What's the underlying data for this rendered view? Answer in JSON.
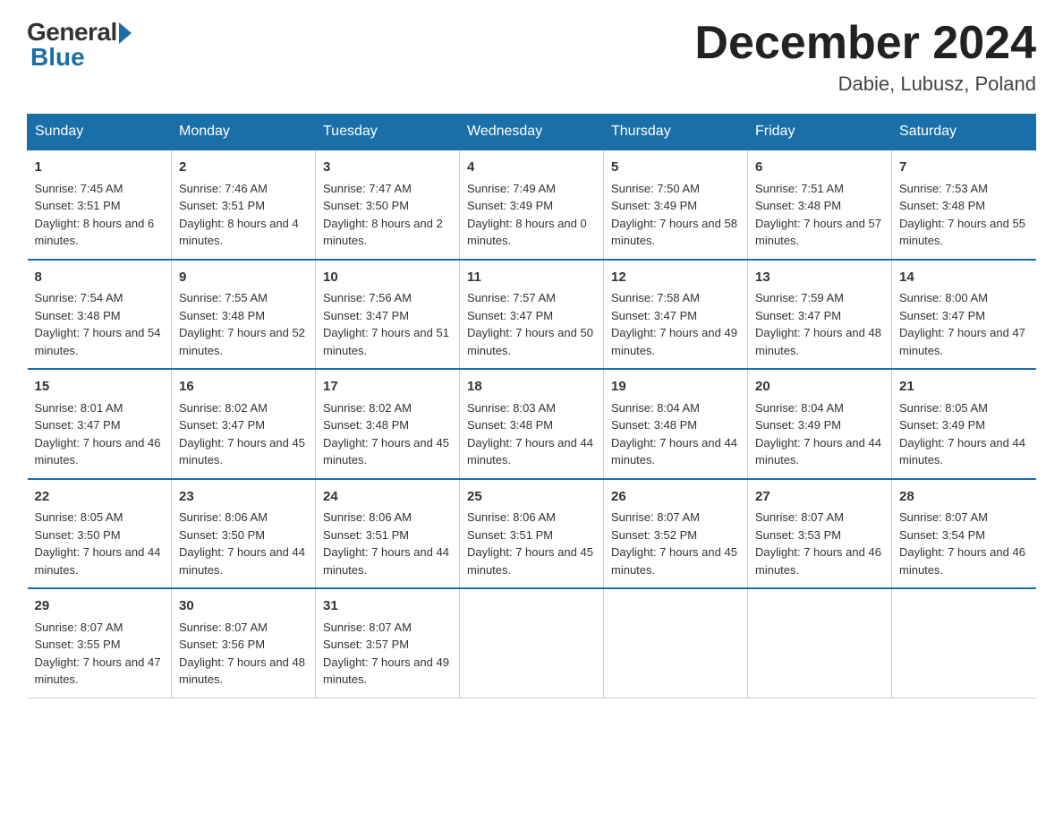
{
  "header": {
    "logo_general": "General",
    "logo_blue": "Blue",
    "title": "December 2024",
    "location": "Dabie, Lubusz, Poland"
  },
  "days_of_week": [
    "Sunday",
    "Monday",
    "Tuesday",
    "Wednesday",
    "Thursday",
    "Friday",
    "Saturday"
  ],
  "weeks": [
    [
      {
        "day": 1,
        "sunrise": "7:45 AM",
        "sunset": "3:51 PM",
        "daylight": "8 hours and 6 minutes."
      },
      {
        "day": 2,
        "sunrise": "7:46 AM",
        "sunset": "3:51 PM",
        "daylight": "8 hours and 4 minutes."
      },
      {
        "day": 3,
        "sunrise": "7:47 AM",
        "sunset": "3:50 PM",
        "daylight": "8 hours and 2 minutes."
      },
      {
        "day": 4,
        "sunrise": "7:49 AM",
        "sunset": "3:49 PM",
        "daylight": "8 hours and 0 minutes."
      },
      {
        "day": 5,
        "sunrise": "7:50 AM",
        "sunset": "3:49 PM",
        "daylight": "7 hours and 58 minutes."
      },
      {
        "day": 6,
        "sunrise": "7:51 AM",
        "sunset": "3:48 PM",
        "daylight": "7 hours and 57 minutes."
      },
      {
        "day": 7,
        "sunrise": "7:53 AM",
        "sunset": "3:48 PM",
        "daylight": "7 hours and 55 minutes."
      }
    ],
    [
      {
        "day": 8,
        "sunrise": "7:54 AM",
        "sunset": "3:48 PM",
        "daylight": "7 hours and 54 minutes."
      },
      {
        "day": 9,
        "sunrise": "7:55 AM",
        "sunset": "3:48 PM",
        "daylight": "7 hours and 52 minutes."
      },
      {
        "day": 10,
        "sunrise": "7:56 AM",
        "sunset": "3:47 PM",
        "daylight": "7 hours and 51 minutes."
      },
      {
        "day": 11,
        "sunrise": "7:57 AM",
        "sunset": "3:47 PM",
        "daylight": "7 hours and 50 minutes."
      },
      {
        "day": 12,
        "sunrise": "7:58 AM",
        "sunset": "3:47 PM",
        "daylight": "7 hours and 49 minutes."
      },
      {
        "day": 13,
        "sunrise": "7:59 AM",
        "sunset": "3:47 PM",
        "daylight": "7 hours and 48 minutes."
      },
      {
        "day": 14,
        "sunrise": "8:00 AM",
        "sunset": "3:47 PM",
        "daylight": "7 hours and 47 minutes."
      }
    ],
    [
      {
        "day": 15,
        "sunrise": "8:01 AM",
        "sunset": "3:47 PM",
        "daylight": "7 hours and 46 minutes."
      },
      {
        "day": 16,
        "sunrise": "8:02 AM",
        "sunset": "3:47 PM",
        "daylight": "7 hours and 45 minutes."
      },
      {
        "day": 17,
        "sunrise": "8:02 AM",
        "sunset": "3:48 PM",
        "daylight": "7 hours and 45 minutes."
      },
      {
        "day": 18,
        "sunrise": "8:03 AM",
        "sunset": "3:48 PM",
        "daylight": "7 hours and 44 minutes."
      },
      {
        "day": 19,
        "sunrise": "8:04 AM",
        "sunset": "3:48 PM",
        "daylight": "7 hours and 44 minutes."
      },
      {
        "day": 20,
        "sunrise": "8:04 AM",
        "sunset": "3:49 PM",
        "daylight": "7 hours and 44 minutes."
      },
      {
        "day": 21,
        "sunrise": "8:05 AM",
        "sunset": "3:49 PM",
        "daylight": "7 hours and 44 minutes."
      }
    ],
    [
      {
        "day": 22,
        "sunrise": "8:05 AM",
        "sunset": "3:50 PM",
        "daylight": "7 hours and 44 minutes."
      },
      {
        "day": 23,
        "sunrise": "8:06 AM",
        "sunset": "3:50 PM",
        "daylight": "7 hours and 44 minutes."
      },
      {
        "day": 24,
        "sunrise": "8:06 AM",
        "sunset": "3:51 PM",
        "daylight": "7 hours and 44 minutes."
      },
      {
        "day": 25,
        "sunrise": "8:06 AM",
        "sunset": "3:51 PM",
        "daylight": "7 hours and 45 minutes."
      },
      {
        "day": 26,
        "sunrise": "8:07 AM",
        "sunset": "3:52 PM",
        "daylight": "7 hours and 45 minutes."
      },
      {
        "day": 27,
        "sunrise": "8:07 AM",
        "sunset": "3:53 PM",
        "daylight": "7 hours and 46 minutes."
      },
      {
        "day": 28,
        "sunrise": "8:07 AM",
        "sunset": "3:54 PM",
        "daylight": "7 hours and 46 minutes."
      }
    ],
    [
      {
        "day": 29,
        "sunrise": "8:07 AM",
        "sunset": "3:55 PM",
        "daylight": "7 hours and 47 minutes."
      },
      {
        "day": 30,
        "sunrise": "8:07 AM",
        "sunset": "3:56 PM",
        "daylight": "7 hours and 48 minutes."
      },
      {
        "day": 31,
        "sunrise": "8:07 AM",
        "sunset": "3:57 PM",
        "daylight": "7 hours and 49 minutes."
      },
      null,
      null,
      null,
      null
    ]
  ],
  "labels": {
    "sunrise": "Sunrise:",
    "sunset": "Sunset:",
    "daylight": "Daylight:"
  }
}
